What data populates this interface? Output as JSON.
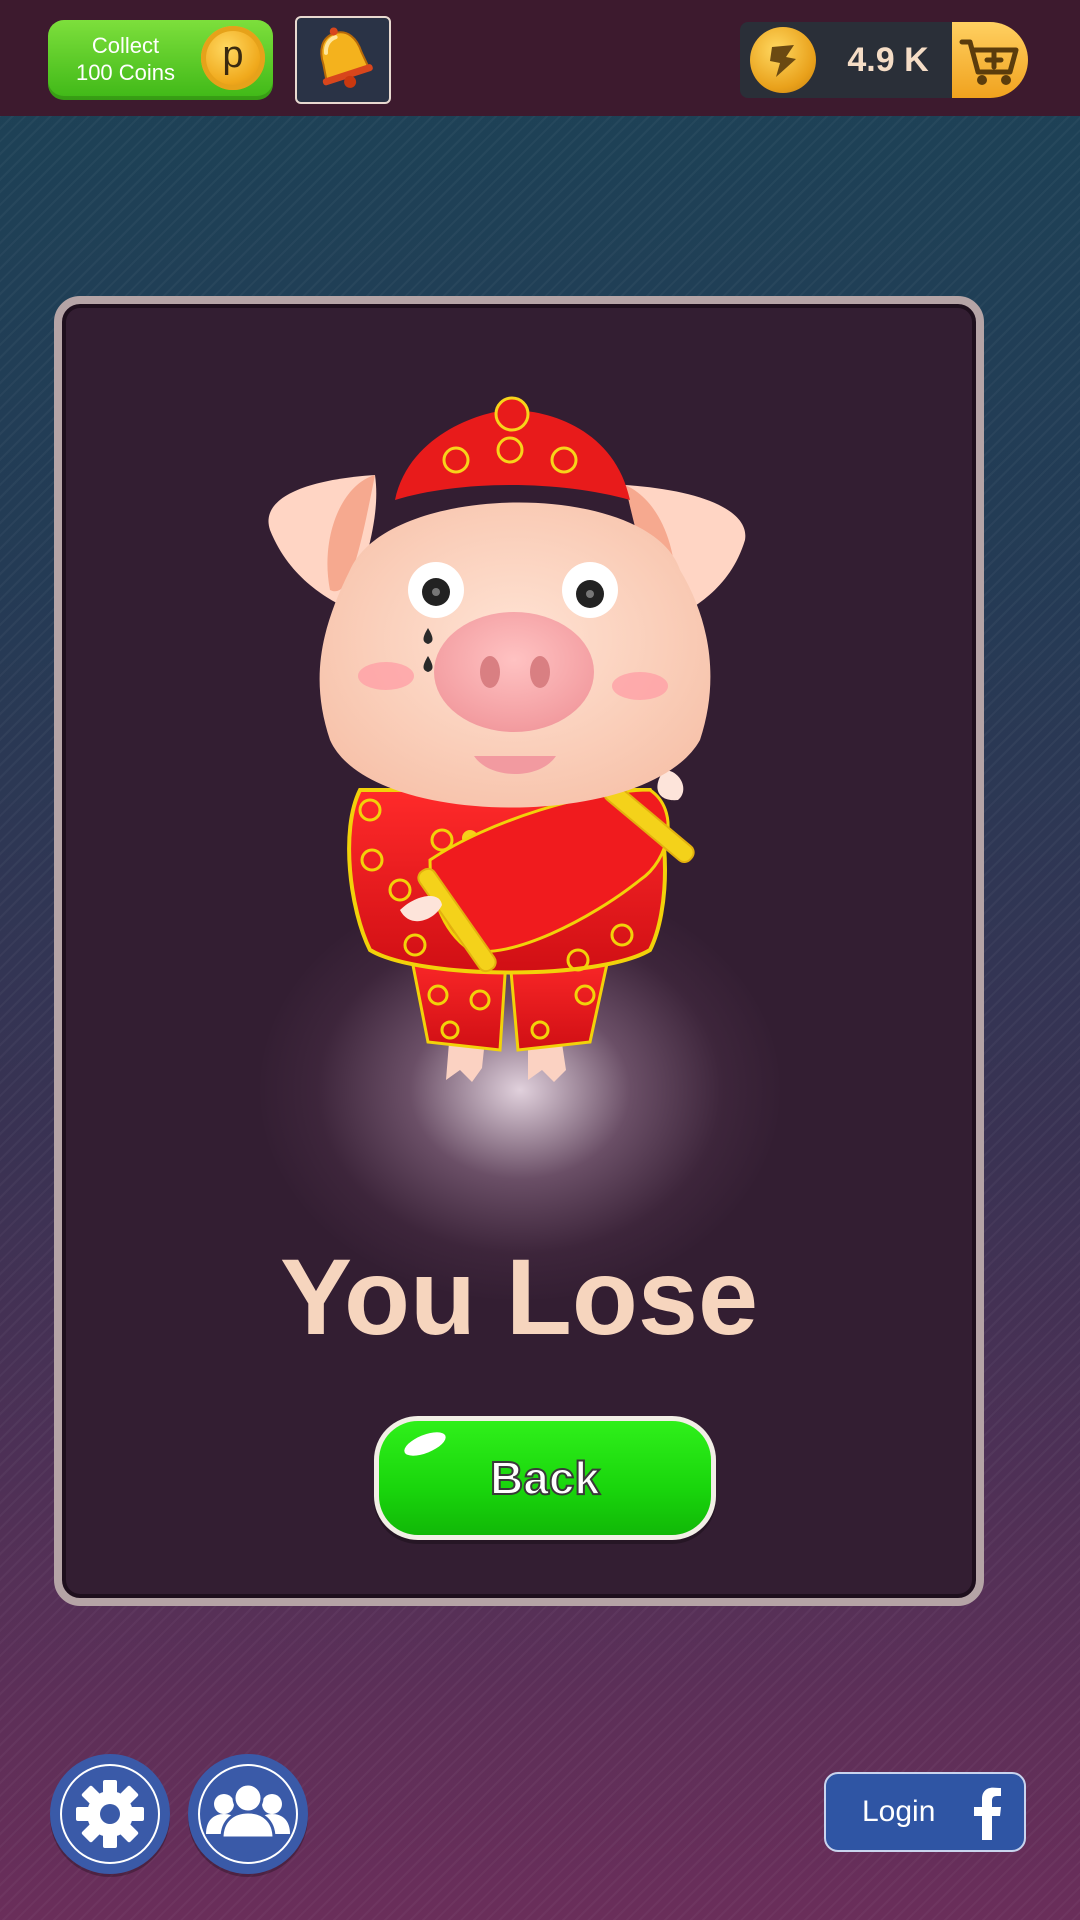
{
  "topbar": {
    "collect_label_line1": "Collect",
    "collect_label_line2": "100 Coins",
    "collect_coin_letter": "p",
    "coin_balance": "4.9 K",
    "icons": [
      "coin-icon",
      "bell-icon",
      "coin-icon",
      "cart-plus-icon"
    ]
  },
  "result": {
    "title": "You Lose",
    "back_label": "Back"
  },
  "footer": {
    "login_label": "Login",
    "icons": [
      "gear-icon",
      "friends-icon",
      "facebook-icon"
    ]
  },
  "colors": {
    "topbar_bg": "#3d1a2e",
    "panel_bg": "#331e32",
    "panel_border": "#b5a4a6",
    "title_text": "#f6d5be",
    "back_button": "#19d50c",
    "collect_button": "#3fb817",
    "coin_gold": "#f0a91c",
    "footer_button_blue": "#3a5aa8"
  }
}
